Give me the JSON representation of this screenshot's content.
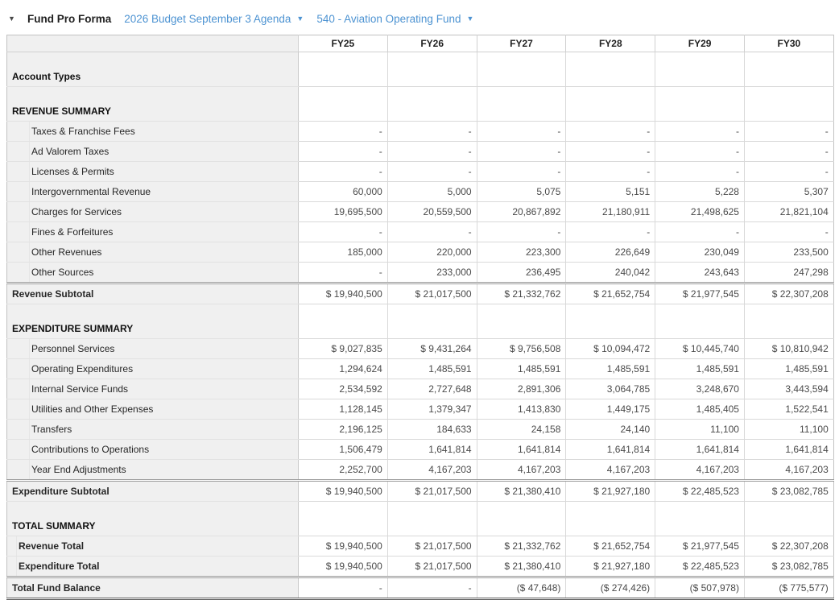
{
  "toolbar": {
    "collapse_icon": "▼",
    "title": "Fund Pro Forma",
    "budget_dropdown": {
      "label": "2026 Budget September 3 Agenda",
      "caret": "▼"
    },
    "fund_dropdown": {
      "label": "540 - Aviation Operating Fund",
      "caret": "▼"
    }
  },
  "colors": {
    "link_blue": "#4d93d2",
    "label_column_bg": "#f0f0f0",
    "grid_line": "#d9d9d9"
  },
  "table": {
    "columns": [
      "FY25",
      "FY26",
      "FY27",
      "FY28",
      "FY29",
      "FY30"
    ],
    "rows": [
      {
        "type": "section",
        "label": "Account Types",
        "values": [
          "",
          "",
          "",
          "",
          "",
          ""
        ]
      },
      {
        "type": "section",
        "label": "REVENUE SUMMARY",
        "values": [
          "",
          "",
          "",
          "",
          "",
          ""
        ]
      },
      {
        "type": "detail",
        "label": "Taxes & Franchise Fees",
        "values": [
          "-",
          "-",
          "-",
          "-",
          "-",
          "-"
        ]
      },
      {
        "type": "detail",
        "label": "Ad Valorem Taxes",
        "values": [
          "-",
          "-",
          "-",
          "-",
          "-",
          "-"
        ]
      },
      {
        "type": "detail",
        "label": "Licenses & Permits",
        "values": [
          "-",
          "-",
          "-",
          "-",
          "-",
          "-"
        ]
      },
      {
        "type": "detail",
        "label": "Intergovernmental Revenue",
        "values": [
          "60,000",
          "5,000",
          "5,075",
          "5,151",
          "5,228",
          "5,307"
        ]
      },
      {
        "type": "detail",
        "label": "Charges for Services",
        "values": [
          "19,695,500",
          "20,559,500",
          "20,867,892",
          "21,180,911",
          "21,498,625",
          "21,821,104"
        ]
      },
      {
        "type": "detail",
        "label": "Fines & Forfeitures",
        "values": [
          "-",
          "-",
          "-",
          "-",
          "-",
          "-"
        ]
      },
      {
        "type": "detail",
        "label": "Other Revenues",
        "values": [
          "185,000",
          "220,000",
          "223,300",
          "226,649",
          "230,049",
          "233,500"
        ]
      },
      {
        "type": "detail",
        "label": "Other Sources",
        "values": [
          "-",
          "233,000",
          "236,495",
          "240,042",
          "243,643",
          "247,298"
        ]
      },
      {
        "type": "subtotal",
        "label": "Revenue Subtotal",
        "values": [
          "$ 19,940,500",
          "$ 21,017,500",
          "$ 21,332,762",
          "$ 21,652,754",
          "$ 21,977,545",
          "$ 22,307,208"
        ]
      },
      {
        "type": "section",
        "label": "EXPENDITURE SUMMARY",
        "values": [
          "",
          "",
          "",
          "",
          "",
          ""
        ]
      },
      {
        "type": "detail",
        "label": "Personnel Services",
        "values": [
          "$ 9,027,835",
          "$ 9,431,264",
          "$ 9,756,508",
          "$ 10,094,472",
          "$ 10,445,740",
          "$ 10,810,942"
        ]
      },
      {
        "type": "detail",
        "label": "Operating Expenditures",
        "values": [
          "1,294,624",
          "1,485,591",
          "1,485,591",
          "1,485,591",
          "1,485,591",
          "1,485,591"
        ]
      },
      {
        "type": "detail",
        "label": "Internal Service Funds",
        "values": [
          "2,534,592",
          "2,727,648",
          "2,891,306",
          "3,064,785",
          "3,248,670",
          "3,443,594"
        ]
      },
      {
        "type": "detail",
        "label": "Utilities and Other Expenses",
        "values": [
          "1,128,145",
          "1,379,347",
          "1,413,830",
          "1,449,175",
          "1,485,405",
          "1,522,541"
        ]
      },
      {
        "type": "detail",
        "label": "Transfers",
        "values": [
          "2,196,125",
          "184,633",
          "24,158",
          "24,140",
          "11,100",
          "11,100"
        ]
      },
      {
        "type": "detail",
        "label": "Contributions to Operations",
        "values": [
          "1,506,479",
          "1,641,814",
          "1,641,814",
          "1,641,814",
          "1,641,814",
          "1,641,814"
        ]
      },
      {
        "type": "detail",
        "label": "Year End Adjustments",
        "values": [
          "2,252,700",
          "4,167,203",
          "4,167,203",
          "4,167,203",
          "4,167,203",
          "4,167,203"
        ]
      },
      {
        "type": "subtotal",
        "label": "Expenditure Subtotal",
        "values": [
          "$ 19,940,500",
          "$ 21,017,500",
          "$ 21,380,410",
          "$ 21,927,180",
          "$ 22,485,523",
          "$ 23,082,785"
        ]
      },
      {
        "type": "section",
        "label": "TOTAL SUMMARY",
        "values": [
          "",
          "",
          "",
          "",
          "",
          ""
        ]
      },
      {
        "type": "total",
        "label": "Revenue Total",
        "values": [
          "$ 19,940,500",
          "$ 21,017,500",
          "$ 21,332,762",
          "$ 21,652,754",
          "$ 21,977,545",
          "$ 22,307,208"
        ]
      },
      {
        "type": "total",
        "label": "Expenditure Total",
        "values": [
          "$ 19,940,500",
          "$ 21,017,500",
          "$ 21,380,410",
          "$ 21,927,180",
          "$ 22,485,523",
          "$ 23,082,785"
        ]
      },
      {
        "type": "grandtotal",
        "label": "Total Fund Balance",
        "values": [
          "-",
          "-",
          "($ 47,648)",
          "($ 274,426)",
          "($ 507,978)",
          "($ 775,577)"
        ]
      }
    ]
  }
}
